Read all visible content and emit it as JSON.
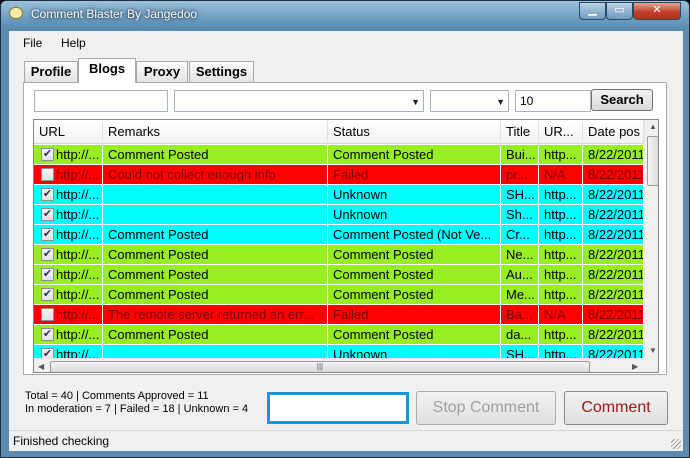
{
  "window": {
    "title": "Comment Blaster By Jangedoo"
  },
  "menu": [
    "File",
    "Help"
  ],
  "tabs": [
    "Profile",
    "Blogs",
    "Proxy",
    "Settings"
  ],
  "active_tab": "Blogs",
  "filters": {
    "text1": "",
    "combo1": "",
    "combo2": "",
    "count": "10",
    "search_label": "Search"
  },
  "grid": {
    "columns": [
      "URL",
      "Remarks",
      "Status",
      "Title",
      "UR...",
      "Date pos"
    ],
    "rows": [
      {
        "checked": true,
        "color": "#99ee22",
        "textcolor": "#000000",
        "url": "http://...",
        "remarks": "Comment Posted",
        "status": "Comment Posted",
        "title": "Bui...",
        "ur": "http...",
        "date": "8/22/2011"
      },
      {
        "checked": false,
        "color": "#ff0000",
        "textcolor": "#7a0000",
        "url": "http://...",
        "remarks": "Could not collect enough info",
        "status": "Failed",
        "title": "pr...",
        "ur": "N/A",
        "date": "8/22/2011"
      },
      {
        "checked": true,
        "color": "#00ffff",
        "textcolor": "#000000",
        "url": "http://...",
        "remarks": "",
        "status": "Unknown",
        "title": "SH...",
        "ur": "http...",
        "date": "8/22/2011"
      },
      {
        "checked": true,
        "color": "#00ffff",
        "textcolor": "#000000",
        "url": "http://...",
        "remarks": "",
        "status": "Unknown",
        "title": "Sh...",
        "ur": "http...",
        "date": "8/22/2011"
      },
      {
        "checked": true,
        "color": "#00ffff",
        "textcolor": "#000000",
        "url": "http://...",
        "remarks": "Comment Posted",
        "status": "Comment Posted (Not Ve...",
        "title": "Cr...",
        "ur": "http...",
        "date": "8/22/2011"
      },
      {
        "checked": true,
        "color": "#99ee22",
        "textcolor": "#000000",
        "url": "http://...",
        "remarks": "Comment Posted",
        "status": "Comment Posted",
        "title": "Ne...",
        "ur": "http...",
        "date": "8/22/2011"
      },
      {
        "checked": true,
        "color": "#99ee22",
        "textcolor": "#000000",
        "url": "http://...",
        "remarks": "Comment Posted",
        "status": "Comment Posted",
        "title": "Au...",
        "ur": "http...",
        "date": "8/22/2011"
      },
      {
        "checked": true,
        "color": "#99ee22",
        "textcolor": "#000000",
        "url": "http://...",
        "remarks": "Comment Posted",
        "status": "Comment Posted",
        "title": "Me...",
        "ur": "http...",
        "date": "8/22/2011"
      },
      {
        "checked": false,
        "color": "#ff0000",
        "textcolor": "#7a0000",
        "url": "http://...",
        "remarks": "The remote server returned an err...",
        "status": "Failed",
        "title": "Ba...",
        "ur": "N/A",
        "date": "8/22/2011"
      },
      {
        "checked": true,
        "color": "#99ee22",
        "textcolor": "#000000",
        "url": "http://...",
        "remarks": "Comment Posted",
        "status": "Comment Posted",
        "title": "da...",
        "ur": "http...",
        "date": "8/22/2011"
      },
      {
        "checked": true,
        "color": "#00ffff",
        "textcolor": "#000000",
        "url": "http://...",
        "remarks": "",
        "status": "Unknown",
        "title": "SH...",
        "ur": "http...",
        "date": "8/22/2011"
      }
    ]
  },
  "summary": {
    "line1": "Total = 40 | Comments Approved = 11",
    "line2": "In moderation = 7 | Failed = 18 | Unknown = 4"
  },
  "comment_input": "",
  "buttons": {
    "stop": "Stop Comment",
    "comment": "Comment"
  },
  "status_bar": "Finished checking"
}
